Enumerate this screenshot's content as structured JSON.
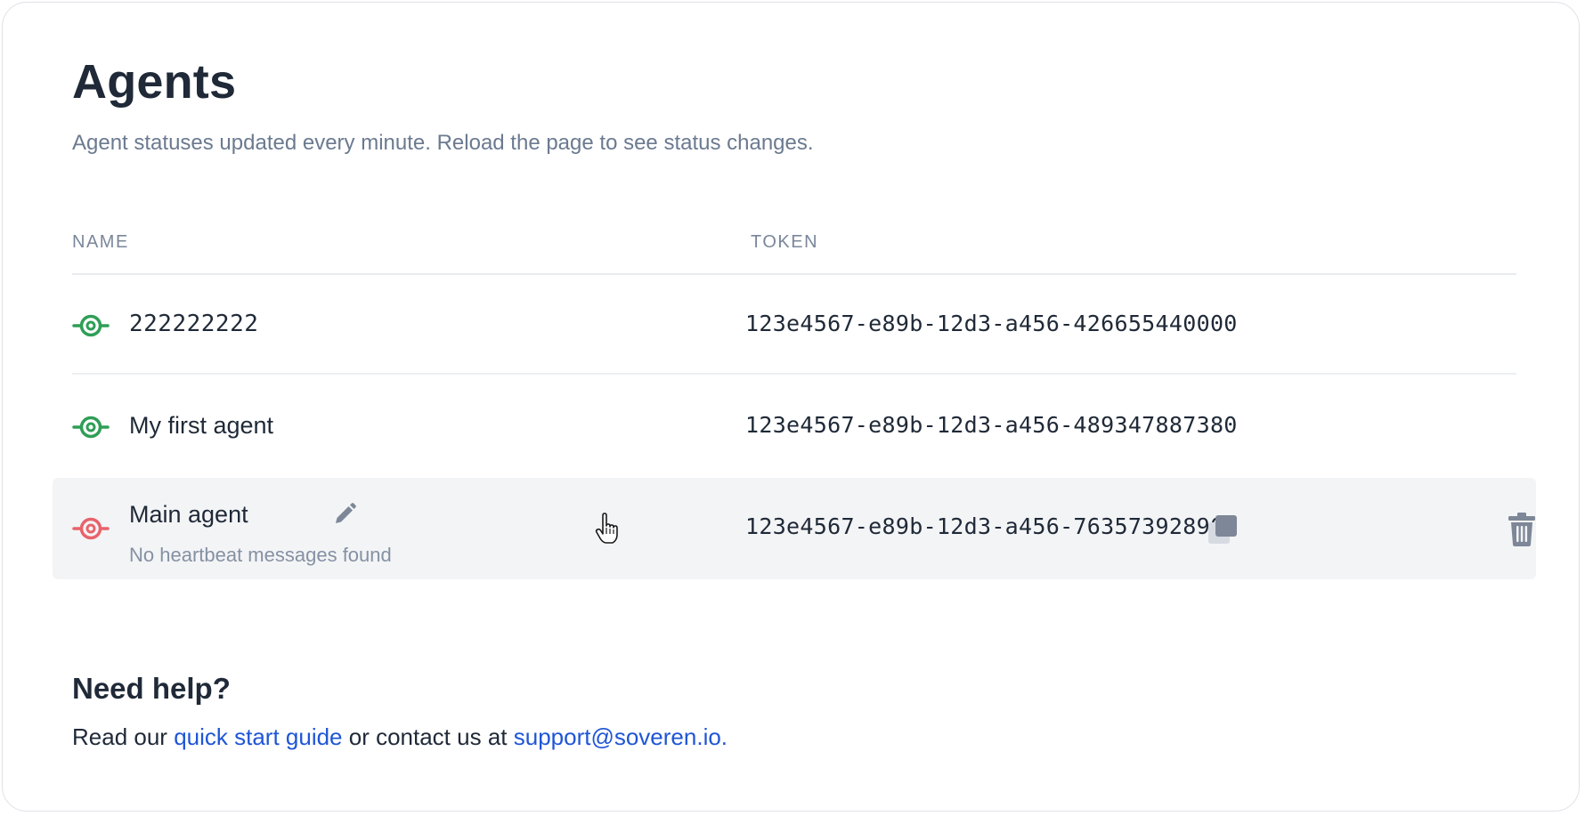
{
  "page": {
    "title": "Agents",
    "subtitle": "Agent statuses updated every minute. Reload the page to see status changes."
  },
  "table": {
    "columns": {
      "name": "NAME",
      "token": "TOKEN"
    },
    "rows": [
      {
        "name": "222222222",
        "token": "123e4567-e89b-12d3-a456-426655440000",
        "status": "online",
        "status_icon": "online-signal-icon"
      },
      {
        "name": "My first agent",
        "token": "123e4567-e89b-12d3-a456-489347887380",
        "status": "online",
        "status_icon": "online-signal-icon"
      },
      {
        "name": "Main agent",
        "hint": "No heartbeat messages found",
        "token": "123e4567-e89b-12d3-a456-763573928900",
        "status": "offline",
        "status_icon": "offline-signal-icon",
        "actions": {
          "edit_icon": "pencil-icon",
          "copy_icon": "copy-icon",
          "delete_icon": "trash-icon"
        }
      }
    ]
  },
  "help": {
    "title": "Need help?",
    "text_before": "Read our ",
    "guide_link": "quick start guide",
    "text_middle": " or contact us at ",
    "email_link": "support@soveren.io."
  },
  "colors": {
    "online": "#2f9e57",
    "offline": "#e8636a",
    "link": "#1f55d6",
    "muted": "#6b7a90",
    "text": "#1f2937",
    "row_highlight": "#f3f4f6"
  },
  "cursor": {
    "icon": "hand-pointer-icon"
  }
}
